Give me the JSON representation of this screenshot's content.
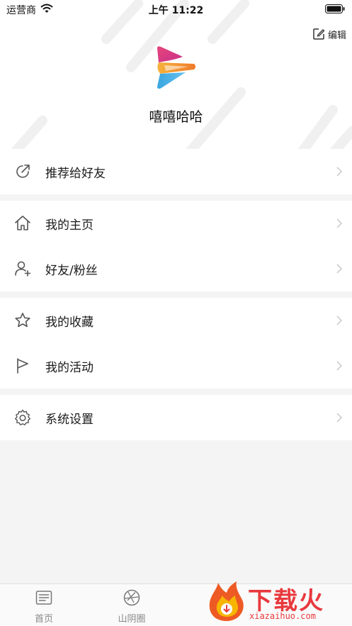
{
  "status_bar": {
    "carrier": "运营商",
    "time": "上午 11:22"
  },
  "header": {
    "edit_label": "编辑",
    "username": "嘻嘻哈哈"
  },
  "menu": {
    "share": "推荐给好友",
    "homepage": "我的主页",
    "friends": "好友/粉丝",
    "favorites": "我的收藏",
    "activities": "我的活动",
    "settings": "系统设置"
  },
  "tabbar": {
    "tabs": [
      {
        "label": "首页",
        "icon": "news-list-icon"
      },
      {
        "label": "山阴圈",
        "icon": "aperture-icon"
      }
    ]
  },
  "watermark": {
    "title": "下载火",
    "subtitle": "xiazaihuo.com"
  },
  "colors": {
    "accent": "#e8393d",
    "icon_gray": "#555555",
    "chevron": "#c8c8c8",
    "background": "#f4f4f4"
  }
}
